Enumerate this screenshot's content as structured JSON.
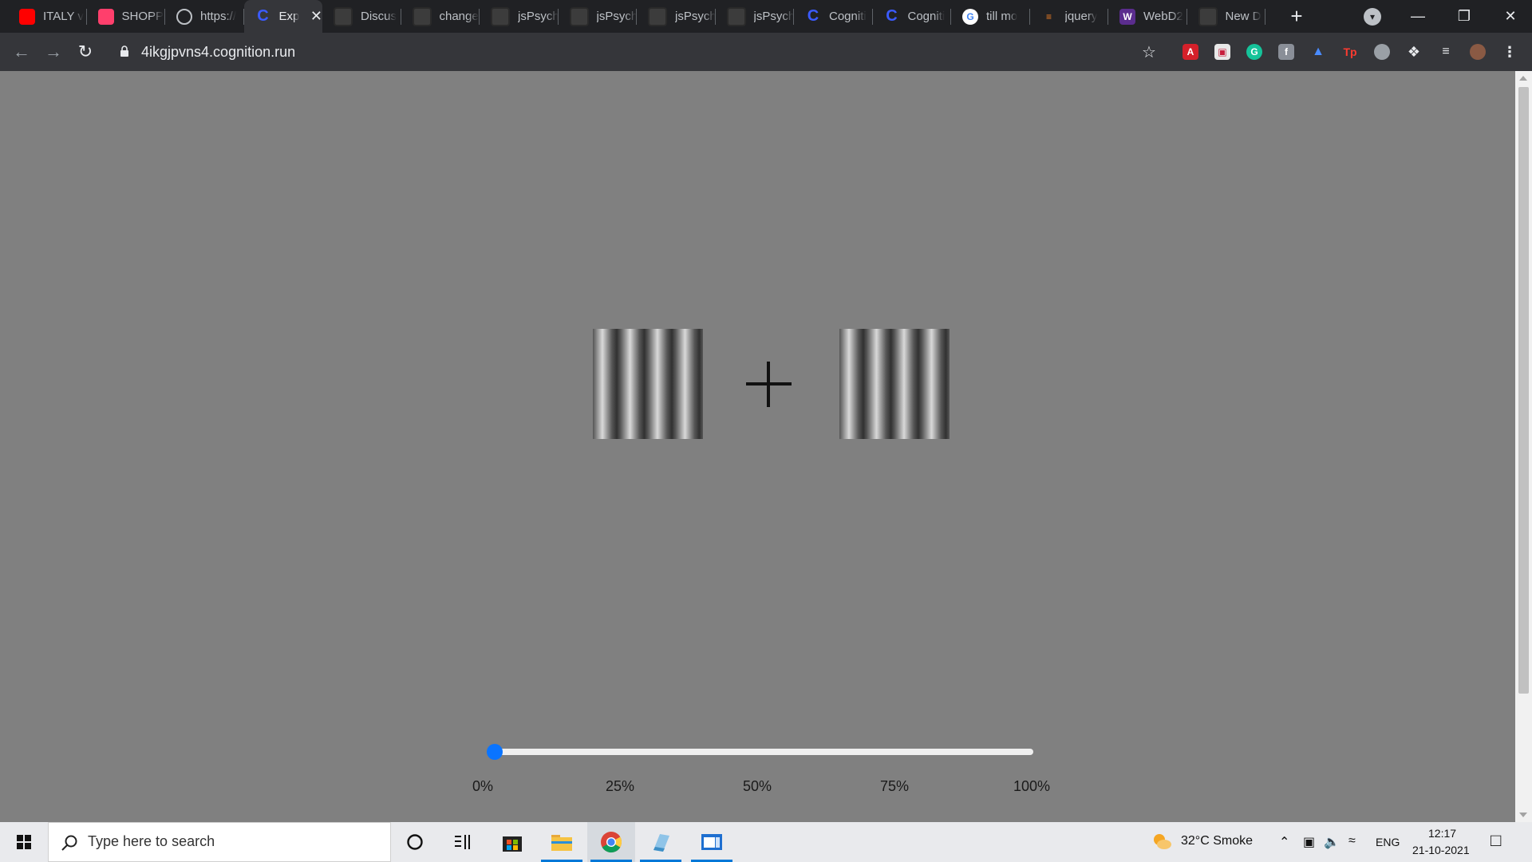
{
  "browser": {
    "tabs": [
      {
        "title": "ITALY v",
        "icon": "youtube-icon",
        "color": "#ff0000"
      },
      {
        "title": "SHOPP",
        "icon": "myntra-icon",
        "color": "#ff3f6c"
      },
      {
        "title": "https://",
        "icon": "globe-icon",
        "color": "#bdc1c6"
      },
      {
        "title": "Exp",
        "icon": "cognition-icon",
        "color": "#3b5bff",
        "active": true
      },
      {
        "title": "Discus",
        "icon": "github-icon"
      },
      {
        "title": "change",
        "icon": "github-icon"
      },
      {
        "title": "jsPsych",
        "icon": "github-icon"
      },
      {
        "title": "jsPsych",
        "icon": "github-icon"
      },
      {
        "title": "jsPsych",
        "icon": "github-icon"
      },
      {
        "title": "jsPsych",
        "icon": "github-icon"
      },
      {
        "title": "Cogniti",
        "icon": "cognition-icon",
        "color": "#3b5bff"
      },
      {
        "title": "Cogniti",
        "icon": "cognition-icon",
        "color": "#3b5bff"
      },
      {
        "title": "till mo",
        "icon": "google-icon",
        "color": "#4285f4"
      },
      {
        "title": "jquery",
        "icon": "stackoverflow-icon",
        "color": "#f48024"
      },
      {
        "title": "WebD2",
        "icon": "webd-icon",
        "color": "#5b2d8e"
      },
      {
        "title": "New D",
        "icon": "github-icon"
      }
    ],
    "url": "4ikgjpvns4.cognition.run"
  },
  "experiment": {
    "slider": {
      "value_percent": 0,
      "labels": [
        "0%",
        "25%",
        "50%",
        "75%",
        "100%"
      ],
      "accent_color": "#0a74ff"
    },
    "background_color": "#808080"
  },
  "taskbar": {
    "search_placeholder": "Type here to search",
    "weather": "32°C  Smoke",
    "language": "ENG",
    "time": "12:17",
    "date": "21-10-2021"
  }
}
